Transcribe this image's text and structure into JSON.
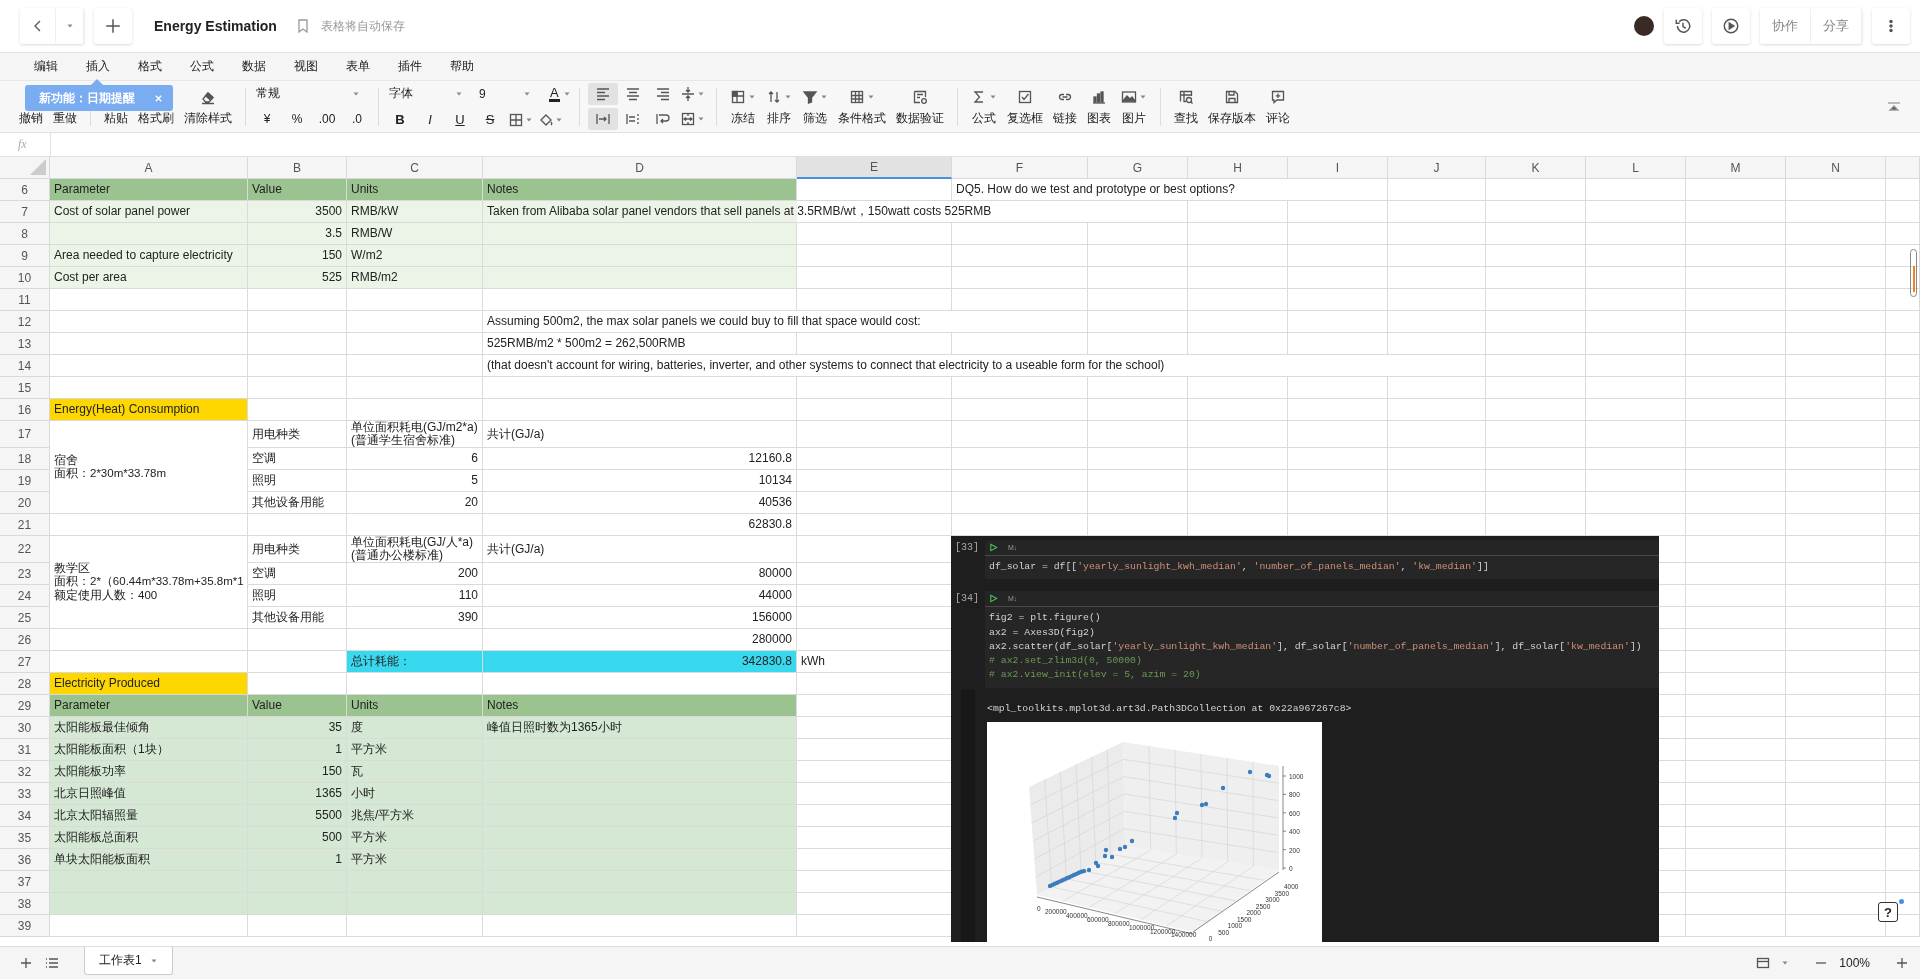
{
  "header": {
    "title": "Energy Estimation",
    "save_status": "表格将自动保存",
    "buttons": [
      "协作",
      "分享"
    ]
  },
  "menu": [
    "编辑",
    "插入",
    "格式",
    "公式",
    "数据",
    "视图",
    "表单",
    "插件",
    "帮助"
  ],
  "tooltip": {
    "text": "新功能：日期提醒"
  },
  "toolbar": {
    "edit": [
      {
        "label": "撤销"
      },
      {
        "label": "重做"
      }
    ],
    "clipboard": [
      {
        "label": "粘贴"
      },
      {
        "label": "格式刷"
      },
      {
        "label": "清除样式",
        "kind": "clear"
      }
    ],
    "number_format": "常规",
    "number_buttons": [
      "¥",
      "%",
      ".00",
      ".0"
    ],
    "font_family": "字体",
    "font_size": "9",
    "font_color": "A",
    "text_buttons": [
      "B",
      "I",
      "U",
      "S"
    ],
    "alignment": [
      {
        "kind": "left",
        "selected": true
      },
      {
        "kind": "center",
        "selected": false
      },
      {
        "kind": "right",
        "selected": false
      },
      {
        "kind": "valign",
        "selected": false
      },
      {
        "kind": "overflow",
        "selected": true
      },
      {
        "kind": "clip",
        "selected": false
      },
      {
        "kind": "wrap",
        "selected": false
      },
      {
        "kind": "merge",
        "selected": false
      }
    ],
    "data_tools": [
      {
        "label": "冻结",
        "kind": "freeze"
      },
      {
        "label": "排序",
        "kind": "sort"
      },
      {
        "label": "筛选",
        "kind": "filter"
      },
      {
        "label": "条件格式",
        "kind": "conditional"
      },
      {
        "label": "数据验证",
        "kind": "validation"
      }
    ],
    "insert_tools": [
      {
        "label": "公式",
        "kind": "sum"
      },
      {
        "label": "复选框",
        "kind": "checkbox"
      },
      {
        "label": "链接",
        "kind": "link"
      },
      {
        "label": "图表",
        "kind": "chart"
      },
      {
        "label": "图片",
        "kind": "image"
      }
    ],
    "other_tools": [
      {
        "label": "查找",
        "kind": "find"
      },
      {
        "label": "保存版本",
        "kind": "save"
      },
      {
        "label": "评论",
        "kind": "comment"
      }
    ]
  },
  "formula_bar": {
    "label": "fx"
  },
  "columns": [
    {
      "label": "A",
      "selected": false
    },
    {
      "label": "B",
      "selected": false
    },
    {
      "label": "C",
      "selected": false
    },
    {
      "label": "D",
      "selected": false
    },
    {
      "label": "E",
      "selected": true
    },
    {
      "label": "F",
      "selected": false
    },
    {
      "label": "G",
      "selected": false
    },
    {
      "label": "H",
      "selected": false
    },
    {
      "label": "I",
      "selected": false
    },
    {
      "label": "J",
      "selected": false
    },
    {
      "label": "K",
      "selected": false
    },
    {
      "label": "L",
      "selected": false
    },
    {
      "label": "M",
      "selected": false
    },
    {
      "label": "N",
      "selected": false
    }
  ],
  "rows": [
    {
      "n": "6",
      "cells": [
        {
          "text": "Parameter",
          "color": "#9bc38f"
        },
        {
          "text": "Value",
          "color": "#9bc38f"
        },
        {
          "text": "Units",
          "color": "#9bc38f"
        },
        {
          "text": "Notes",
          "color": "#9bc38f"
        },
        {},
        {
          "text": "DQ5. How do we test and prototype or best options?"
        }
      ]
    },
    {
      "n": "7",
      "cells": [
        {
          "text": "Cost of solar panel power",
          "color": "#ebf4e6"
        },
        {
          "text": "3500",
          "numeric": true,
          "color": "#ebf4e6"
        },
        {
          "text": "RMB/kW",
          "color": "#ebf4e6"
        },
        {
          "text": "Taken from Alibaba solar panel vendors that sell panels at 3.5RMB/wt，150watt costs 525RMB",
          "color": "#ebf4e6"
        }
      ]
    },
    {
      "n": "8",
      "cells": [
        {
          "color": "#ebf4e6"
        },
        {
          "text": "3.5",
          "numeric": true,
          "color": "#ebf4e6"
        },
        {
          "text": "RMB/W",
          "color": "#ebf4e6"
        },
        {
          "color": "#ebf4e6"
        }
      ]
    },
    {
      "n": "9",
      "cells": [
        {
          "text": "Area needed to capture electricity",
          "color": "#ebf4e6"
        },
        {
          "text": "150",
          "numeric": true,
          "color": "#ebf4e6"
        },
        {
          "text": "W/m2",
          "color": "#ebf4e6"
        },
        {
          "color": "#ebf4e6"
        }
      ]
    },
    {
      "n": "10",
      "cells": [
        {
          "text": "Cost per area",
          "color": "#ebf4e6"
        },
        {
          "text": "525",
          "numeric": true,
          "color": "#ebf4e6"
        },
        {
          "text": "RMB/m2",
          "color": "#ebf4e6"
        },
        {
          "color": "#ebf4e6"
        }
      ]
    },
    {
      "n": "11"
    },
    {
      "n": "12",
      "cells": [
        {},
        {},
        {},
        {
          "text": "Assuming 500m2, the max solar panels we could buy to fill that space would cost:"
        }
      ]
    },
    {
      "n": "13",
      "cells": [
        {},
        {},
        {},
        {
          "text": "525RMB/m2 * 500m2 = 262,500RMB"
        }
      ]
    },
    {
      "n": "14",
      "cells": [
        {},
        {},
        {},
        {
          "text": "(that doesn't account for wiring, batteries, inverter, and other systems to connect that electricity to a useable form for the school)"
        }
      ]
    },
    {
      "n": "15"
    },
    {
      "n": "16",
      "cells": [
        {
          "text": "Energy(Heat) Consumption",
          "color": "#ffd700"
        }
      ]
    },
    {
      "n": "17",
      "cells": [
        {
          "lines": [
            "宿舍",
            "面积：2*30m*33.78m"
          ]
        },
        {
          "text": "用电种类"
        },
        {
          "lines": [
            "单位面积耗电(GJ/m2*a)",
            "(普通学生宿舍标准)"
          ]
        },
        {
          "text": "共计(GJ/a)"
        }
      ]
    },
    {
      "n": "18",
      "cells": [
        {
          "merged": true
        },
        {
          "text": "空调"
        },
        {
          "text": "6",
          "numeric": true
        },
        {
          "text": "12160.8",
          "numeric": true
        }
      ]
    },
    {
      "n": "19",
      "cells": [
        {
          "merged": true
        },
        {
          "text": "照明"
        },
        {
          "text": "5",
          "numeric": true
        },
        {
          "text": "10134",
          "numeric": true
        }
      ]
    },
    {
      "n": "20",
      "cells": [
        {
          "merged": true
        },
        {
          "text": "其他设备用能"
        },
        {
          "text": "20",
          "numeric": true
        },
        {
          "text": "40536",
          "numeric": true
        }
      ]
    },
    {
      "n": "21",
      "cells": [
        {},
        {},
        {},
        {
          "text": "62830.8",
          "numeric": true
        }
      ]
    },
    {
      "n": "22",
      "cells": [
        {
          "lines": [
            "教学区",
            "面积：2*（60.44m*33.78m+35.8m*1",
            "额定使用人数：400"
          ]
        },
        {
          "text": "用电种类"
        },
        {
          "lines": [
            "单位面积耗电(GJ/人*a)",
            "(普通办公楼标准)"
          ]
        },
        {
          "text": "共计(GJ/a)"
        }
      ]
    },
    {
      "n": "23",
      "cells": [
        {
          "merged": true
        },
        {
          "text": "空调"
        },
        {
          "text": "200",
          "numeric": true
        },
        {
          "text": "80000",
          "numeric": true
        }
      ]
    },
    {
      "n": "24",
      "cells": [
        {
          "merged": true
        },
        {
          "text": "照明"
        },
        {
          "text": "110",
          "numeric": true
        },
        {
          "text": "44000",
          "numeric": true
        }
      ]
    },
    {
      "n": "25",
      "cells": [
        {
          "merged": true
        },
        {
          "text": "其他设备用能"
        },
        {
          "text": "390",
          "numeric": true
        },
        {
          "text": "156000",
          "numeric": true
        }
      ]
    },
    {
      "n": "26",
      "cells": [
        {},
        {},
        {},
        {
          "text": "280000",
          "numeric": true
        }
      ]
    },
    {
      "n": "27",
      "cells": [
        {},
        {},
        {
          "text": "总计耗能：",
          "color": "#38d9ef"
        },
        {
          "text": "342830.8",
          "numeric": true,
          "color": "#38d9ef"
        },
        {
          "text": "kWh"
        }
      ]
    },
    {
      "n": "28",
      "cells": [
        {
          "text": "Electricity Produced",
          "color": "#ffd700"
        }
      ]
    },
    {
      "n": "29",
      "cells": [
        {
          "text": "Parameter",
          "color": "#9bc38f"
        },
        {
          "text": "Value",
          "color": "#9bc38f"
        },
        {
          "text": "Units",
          "color": "#9bc38f"
        },
        {
          "text": "Notes",
          "color": "#9bc38f"
        }
      ]
    },
    {
      "n": "30",
      "cells": [
        {
          "text": "太阳能板最佳倾角",
          "color": "#d5e8d4"
        },
        {
          "text": "35",
          "numeric": true,
          "color": "#d5e8d4"
        },
        {
          "text": "度",
          "color": "#d5e8d4"
        },
        {
          "text": "峰值日照时数为1365小时",
          "color": "#d5e8d4"
        }
      ]
    },
    {
      "n": "31",
      "cells": [
        {
          "text": "太阳能板面积（1块）",
          "color": "#d5e8d4"
        },
        {
          "text": "1",
          "numeric": true,
          "color": "#d5e8d4"
        },
        {
          "text": "平方米",
          "color": "#d5e8d4"
        },
        {
          "color": "#d5e8d4"
        }
      ]
    },
    {
      "n": "32",
      "cells": [
        {
          "text": "太阳能板功率",
          "color": "#d5e8d4"
        },
        {
          "text": "150",
          "numeric": true,
          "color": "#d5e8d4"
        },
        {
          "text": "瓦",
          "color": "#d5e8d4"
        },
        {
          "color": "#d5e8d4"
        }
      ]
    },
    {
      "n": "33",
      "cells": [
        {
          "text": "北京日照峰值",
          "color": "#d5e8d4"
        },
        {
          "text": "1365",
          "numeric": true,
          "color": "#d5e8d4"
        },
        {
          "text": "小时",
          "color": "#d5e8d4"
        },
        {
          "color": "#d5e8d4"
        }
      ]
    },
    {
      "n": "34",
      "cells": [
        {
          "text": "北京太阳辐照量",
          "color": "#d5e8d4"
        },
        {
          "text": "5500",
          "numeric": true,
          "color": "#d5e8d4"
        },
        {
          "text": "兆焦/平方米",
          "color": "#d5e8d4"
        },
        {
          "color": "#d5e8d4"
        }
      ]
    },
    {
      "n": "35",
      "cells": [
        {
          "text": "太阳能板总面积",
          "color": "#d5e8d4"
        },
        {
          "text": "500",
          "numeric": true,
          "color": "#d5e8d4"
        },
        {
          "text": "平方米",
          "color": "#d5e8d4"
        },
        {
          "color": "#d5e8d4"
        }
      ]
    },
    {
      "n": "36",
      "cells": [
        {
          "text": "单块太阳能板面积",
          "color": "#d5e8d4"
        },
        {
          "text": "1",
          "numeric": true,
          "color": "#d5e8d4"
        },
        {
          "text": "平方米",
          "color": "#d5e8d4"
        },
        {
          "color": "#d5e8d4"
        }
      ]
    },
    {
      "n": "37",
      "cells": [
        {
          "color": "#d5e8d4"
        },
        {
          "color": "#d5e8d4"
        },
        {
          "color": "#d5e8d4"
        },
        {
          "color": "#d5e8d4"
        }
      ]
    },
    {
      "n": "38",
      "cells": [
        {
          "color": "#d5e8d4"
        },
        {
          "color": "#d5e8d4"
        },
        {
          "color": "#d5e8d4"
        },
        {
          "color": "#d5e8d4"
        }
      ]
    },
    {
      "n": "39"
    }
  ],
  "notebook": {
    "cells": [
      {
        "prompt": "[33]",
        "tag": "M↓",
        "code": [
          "df_solar = df[['yearly_sunlight_kwh_median', 'number_of_panels_median', 'kw_median']]"
        ]
      },
      {
        "prompt": "[34]",
        "tag": "M↓",
        "code": [
          "fig2 = plt.figure()",
          "ax2 = Axes3D(fig2)",
          "ax2.scatter(df_solar['yearly_sunlight_kwh_median'], df_solar['number_of_panels_median'], df_solar['kw_median'])",
          "# ax2.set_zlim3d(0, 50000)",
          "# ax2.view_init(elev = 5, azim = 20)"
        ],
        "output": "<mpl_toolkits.mplot3d.art3d.Path3DCollection at 0x22a967267c8>",
        "plot": {
          "z_ticks": [
            "1000",
            "800",
            "600",
            "400",
            "200",
            "0"
          ],
          "y_ticks": [
            "4000",
            "3500",
            "3000",
            "2500",
            "2000",
            "1500",
            "1000",
            "500",
            "0"
          ],
          "x_ticks": [
            "0",
            "200000",
            "400000",
            "600000",
            "800000",
            "1000000",
            "1200000",
            "1400000"
          ]
        }
      }
    ]
  },
  "help": "?",
  "sheet_tabs": [
    {
      "label": "工作表1",
      "selected": true
    }
  ],
  "zoom": "100%"
}
